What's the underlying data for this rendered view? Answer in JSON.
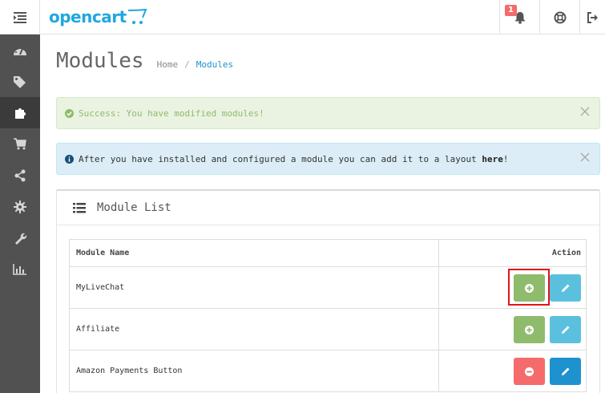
{
  "header": {
    "logo": "opencart",
    "notification_count": "1",
    "menu_icon": "menu-toggle-icon",
    "bell_icon": "bell-icon",
    "help_icon": "life-ring-icon",
    "logout_icon": "logout-icon"
  },
  "sidebar": {
    "items": [
      {
        "icon": "dashboard-icon",
        "active": false
      },
      {
        "icon": "tags-icon",
        "active": false
      },
      {
        "icon": "puzzle-icon",
        "active": true
      },
      {
        "icon": "cart-icon",
        "active": false
      },
      {
        "icon": "share-icon",
        "active": false
      },
      {
        "icon": "cog-icon",
        "active": false
      },
      {
        "icon": "wrench-icon",
        "active": false
      },
      {
        "icon": "bar-chart-icon",
        "active": false
      }
    ]
  },
  "page": {
    "title": "Modules",
    "breadcrumb": {
      "home": "Home",
      "separator": "/",
      "current": "Modules"
    }
  },
  "alerts": {
    "success": "Success: You have modified modules!",
    "info_before": "After you have installed and configured a module you can add it to a layout ",
    "info_link": "here",
    "info_after": "!"
  },
  "panel": {
    "title": "Module List",
    "columns": {
      "name": "Module Name",
      "action": "Action"
    },
    "rows": [
      {
        "name": "MyLiveChat",
        "installed": false
      },
      {
        "name": "Affiliate",
        "installed": false
      },
      {
        "name": "Amazon Payments Button",
        "installed": true
      }
    ]
  },
  "colors": {
    "brand": "#1fa8de",
    "success_btn": "#8fbb6c",
    "danger_btn": "#f56b6b",
    "info_btn": "#5bc0de",
    "primary_btn": "#1e91cf",
    "highlight": "#e2141a"
  }
}
